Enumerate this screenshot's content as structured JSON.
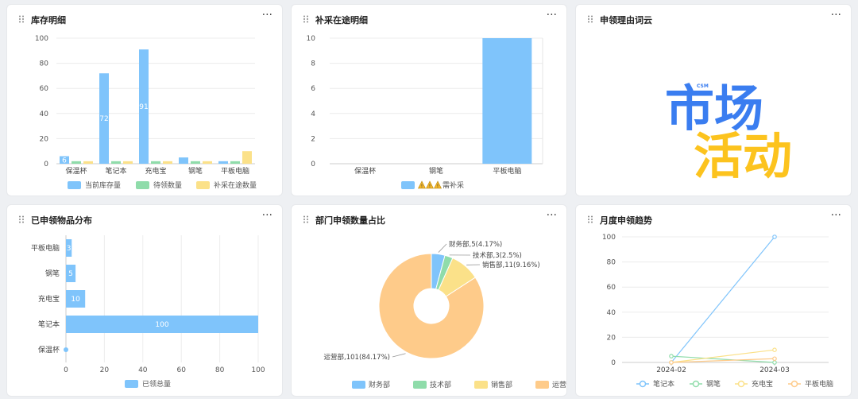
{
  "colors": {
    "blue": "#7fc4fb",
    "green": "#8fdcaa",
    "yellow": "#fbe189",
    "orange": "#fecb8a",
    "word_blue": "#3a7df0",
    "word_yellow": "#fcc31e"
  },
  "icons": {
    "drag": "drag-handle-icon",
    "more": "more-horizontal-icon",
    "warning": "warning-triangle-icon"
  },
  "cards": {
    "inventory": {
      "title": "库存明细",
      "more": "···"
    },
    "replenish": {
      "title": "补采在途明细",
      "more": "···"
    },
    "wordcloud": {
      "title": "申领理由词云",
      "more": "···",
      "small_word": "CSM",
      "word1": "市场",
      "word2": "活动"
    },
    "distribution": {
      "title": "已申领物品分布",
      "more": "···"
    },
    "department": {
      "title": "部门申领数量占比",
      "more": "···"
    },
    "monthly": {
      "title": "月度申领趋势",
      "more": "···"
    }
  },
  "chart_data": [
    {
      "id": "inventory",
      "type": "bar",
      "categories": [
        "保温杯",
        "笔记本",
        "充电宝",
        "钢笔",
        "平板电脑"
      ],
      "series": [
        {
          "name": "当前库存量",
          "values": [
            6,
            72,
            91,
            5,
            2
          ],
          "labels": [
            "6",
            "72",
            "91",
            "",
            ""
          ]
        },
        {
          "name": "待领数量",
          "values": [
            2,
            2,
            2,
            2,
            2
          ]
        },
        {
          "name": "补采在途数量",
          "values": [
            2,
            2,
            2,
            2,
            10
          ]
        }
      ],
      "yticks": [
        "0",
        "20",
        "40",
        "60",
        "80",
        "100"
      ],
      "ylim": [
        0,
        100
      ]
    },
    {
      "id": "replenish",
      "type": "bar",
      "categories": [
        "保温杯",
        "钢笔",
        "平板电脑"
      ],
      "series": [
        {
          "name": "需补采",
          "values": [
            0,
            0,
            10
          ]
        }
      ],
      "yticks": [
        "0",
        "2",
        "4",
        "6",
        "8",
        "10"
      ],
      "ylim": [
        0,
        10
      ]
    },
    {
      "id": "distribution",
      "type": "bar",
      "orientation": "horizontal",
      "categories": [
        "保温杯",
        "笔记本",
        "充电宝",
        "钢笔",
        "平板电脑"
      ],
      "series": [
        {
          "name": "已领总量",
          "values": [
            0,
            100,
            10,
            5,
            3
          ],
          "labels": [
            "",
            "100",
            "10",
            "5",
            "3"
          ]
        }
      ],
      "xticks": [
        "0",
        "20",
        "40",
        "60",
        "80",
        "100"
      ],
      "xlim": [
        0,
        100
      ]
    },
    {
      "id": "department",
      "type": "pie",
      "slices": [
        {
          "name": "财务部",
          "value": 5,
          "label": "财务部,5(4.17%)"
        },
        {
          "name": "技术部",
          "value": 3,
          "label": "技术部,3(2.5%)"
        },
        {
          "name": "销售部",
          "value": 11,
          "label": "销售部,11(9.16%)"
        },
        {
          "name": "运营部",
          "value": 101,
          "label": "运营部,101(84.17%)"
        }
      ]
    },
    {
      "id": "monthly",
      "type": "line",
      "x": [
        "2024-02",
        "2024-03"
      ],
      "series": [
        {
          "name": "笔记本",
          "values": [
            0,
            100
          ]
        },
        {
          "name": "钢笔",
          "values": [
            5,
            0
          ]
        },
        {
          "name": "充电宝",
          "values": [
            0,
            10
          ]
        },
        {
          "name": "平板电脑",
          "values": [
            0,
            3
          ]
        }
      ],
      "yticks": [
        "0",
        "20",
        "40",
        "60",
        "80",
        "100"
      ],
      "ylim": [
        0,
        100
      ]
    }
  ]
}
